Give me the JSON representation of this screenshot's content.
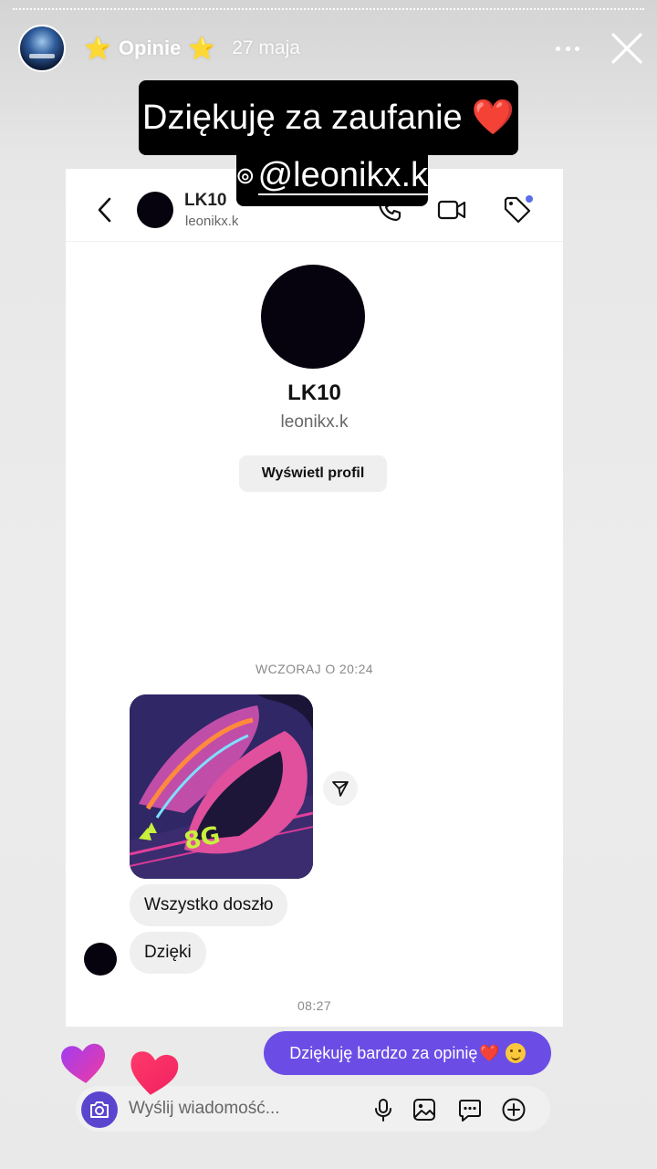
{
  "story": {
    "title": "Opinie",
    "title_star": "⭐",
    "date": "27 maja",
    "caption_line1": "Dziękuję za zaufanie",
    "caption_heart": "❤️",
    "mention": "@leonikx.k"
  },
  "chat_header": {
    "name": "LK10",
    "username": "leonikx.k"
  },
  "profile": {
    "name": "LK10",
    "username": "leonikx.k",
    "view_profile_label": "Wyświetl profil"
  },
  "messages": {
    "timestamp_1": "WCZORAJ O 20:24",
    "incoming": [
      "Wszystko doszło",
      "Dzięki"
    ],
    "timestamp_2": "08:27",
    "outgoing_text": "Dziękuję bardzo za opinię",
    "outgoing_heart": "❤️"
  },
  "composer": {
    "placeholder": "Wyślij wiadomość..."
  },
  "colors": {
    "accent_purple": "#6b4de6",
    "camera_button": "#5a45cf",
    "star": "#f7c531",
    "heart_red": "#e0202f"
  },
  "icons": [
    "back-arrow-icon",
    "phone-icon",
    "video-camera-icon",
    "tag-icon",
    "share-icon",
    "camera-icon",
    "microphone-icon",
    "gallery-icon",
    "sticker-icon",
    "plus-icon",
    "close-icon",
    "more-icon",
    "threads-icon"
  ]
}
